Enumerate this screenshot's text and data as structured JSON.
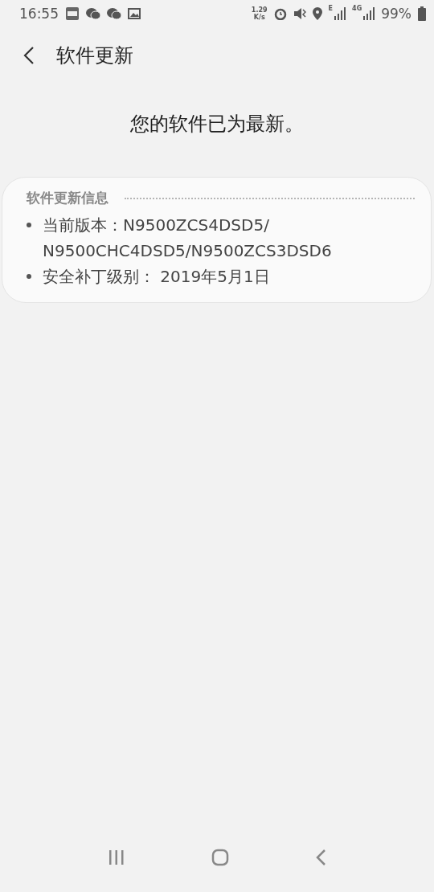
{
  "status_bar": {
    "time": "16:55",
    "net_speed": [
      "1.29",
      "K/s"
    ],
    "network_labels": [
      "E",
      "4G"
    ],
    "battery": "99%"
  },
  "header": {
    "title": "软件更新"
  },
  "message": "您的软件已为最新。",
  "info_card": {
    "title": "软件更新信息",
    "items": [
      {
        "lines": [
          "当前版本：N9500ZCS4DSD5/",
          "N9500CHC4DSD5/N9500ZCS3DSD6"
        ]
      },
      {
        "lines": [
          "安全补丁级别： 2019年5月1日"
        ]
      }
    ]
  }
}
